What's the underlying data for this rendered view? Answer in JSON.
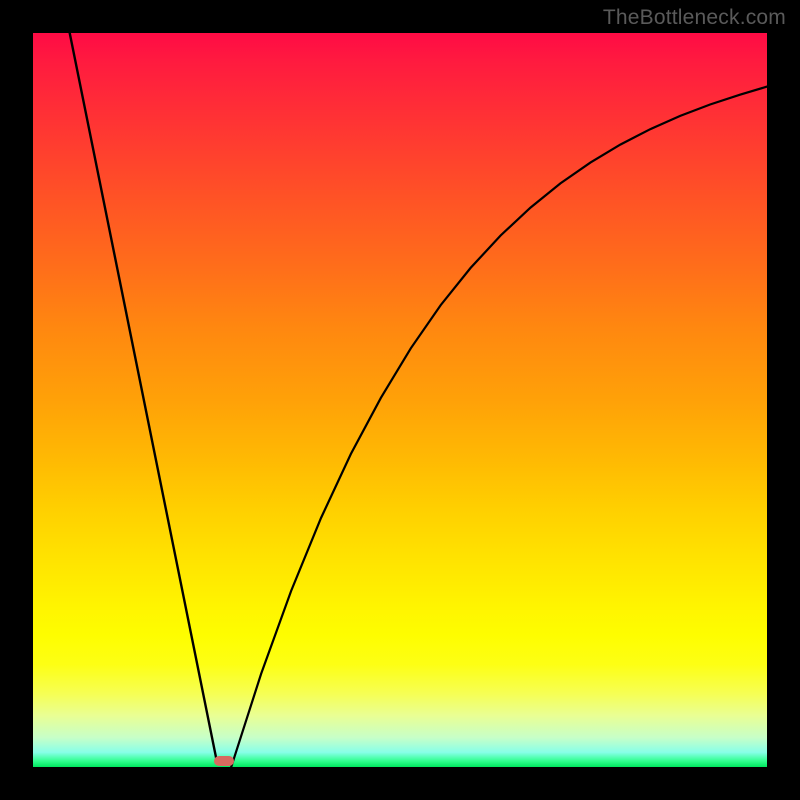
{
  "watermark": "TheBottleneck.com",
  "chart_data": {
    "type": "line",
    "title": "",
    "xlabel": "",
    "ylabel": "",
    "xlim": [
      0,
      100
    ],
    "ylim": [
      0,
      100
    ],
    "grid": false,
    "legend": false,
    "series": [
      {
        "name": "left-branch",
        "x": [
          5.0,
          7.2,
          9.4,
          11.7,
          13.9,
          16.1,
          18.3,
          20.6,
          22.8,
          25.0
        ],
        "values": [
          100,
          87.6,
          75.3,
          62.9,
          50.5,
          38.1,
          25.8,
          13.4,
          1.0,
          0.0
        ]
      },
      {
        "name": "right-branch",
        "x": [
          27.0,
          31.1,
          35.2,
          39.2,
          43.3,
          47.4,
          51.5,
          55.6,
          59.6,
          63.7,
          67.8,
          71.9,
          75.9,
          80.0,
          84.1,
          88.2,
          92.3,
          96.3,
          100.0
        ],
        "values": [
          0.0,
          12.7,
          24.0,
          33.9,
          42.7,
          50.3,
          57.1,
          62.9,
          68.0,
          72.4,
          76.2,
          79.5,
          82.3,
          84.8,
          86.9,
          88.7,
          90.3,
          91.6,
          92.7
        ]
      }
    ],
    "marker": {
      "name": "optimum-marker",
      "x": 26,
      "y": 0,
      "color": "#d76b60"
    },
    "background": {
      "type": "vertical-gradient",
      "stops": [
        {
          "pos": 0.0,
          "color": "#ff0b45"
        },
        {
          "pos": 0.5,
          "color": "#ffa108"
        },
        {
          "pos": 0.82,
          "color": "#fefd00"
        },
        {
          "pos": 1.0,
          "color": "#00e75f"
        }
      ]
    }
  }
}
